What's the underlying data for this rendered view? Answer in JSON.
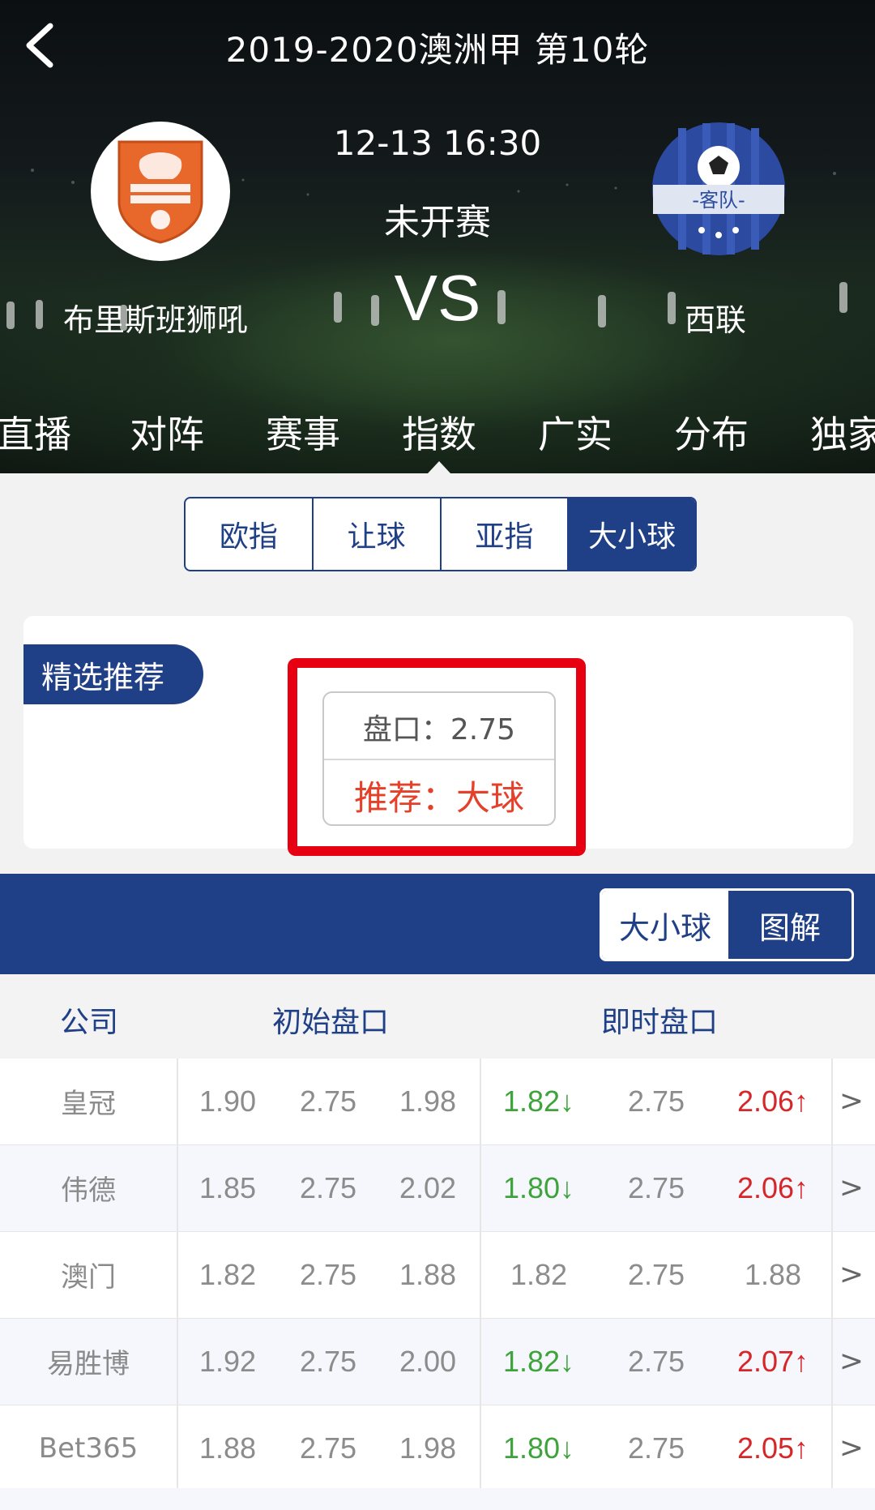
{
  "header": {
    "title": "2019-2020澳洲甲 第10轮",
    "match_time": "12-13 16:30",
    "status": "未开赛",
    "vs": "VS",
    "home_team": "布里斯班狮吼",
    "away_team": "西联",
    "away_logo_text": "-客队-",
    "icons": {
      "back": "chevron-left-icon",
      "home_logo": "brisbane-roar-logo",
      "away_logo": "away-team-shield-logo"
    }
  },
  "tabs": [
    "直播",
    "对阵",
    "赛事",
    "指数",
    "广实",
    "分布",
    "独家"
  ],
  "active_tab": "指数",
  "segmented": [
    "欧指",
    "让球",
    "亚指",
    "大小球"
  ],
  "active_segment": "大小球",
  "recommend": {
    "badge": "精选推荐",
    "line": "盘口：2.75",
    "pick": "推荐：大球"
  },
  "view_toggle": {
    "left": "大小球",
    "right": "图解"
  },
  "table": {
    "headers": {
      "company": "公司",
      "initial": "初始盘口",
      "live": "即时盘口"
    },
    "rows": [
      {
        "company": "皇冠",
        "init": [
          "1.90",
          "2.75",
          "1.98"
        ],
        "live": [
          "1.82↓",
          "2.75",
          "2.06↑"
        ]
      },
      {
        "company": "伟德",
        "init": [
          "1.85",
          "2.75",
          "2.02"
        ],
        "live": [
          "1.80↓",
          "2.75",
          "2.06↑"
        ]
      },
      {
        "company": "澳门",
        "init": [
          "1.82",
          "2.75",
          "1.88"
        ],
        "live": [
          "1.82",
          "2.75",
          "1.88"
        ]
      },
      {
        "company": "易胜博",
        "init": [
          "1.92",
          "2.75",
          "2.00"
        ],
        "live": [
          "1.82↓",
          "2.75",
          "2.07↑"
        ]
      },
      {
        "company": "Bet365",
        "init": [
          "1.88",
          "2.75",
          "1.98"
        ],
        "live": [
          "1.80↓",
          "2.75",
          "2.05↑"
        ]
      }
    ],
    "chevron": ">"
  },
  "colors": {
    "primary": "#1f3f86",
    "up": "#d7262a",
    "down": "#3ea33b",
    "highlight": "#e60012"
  }
}
